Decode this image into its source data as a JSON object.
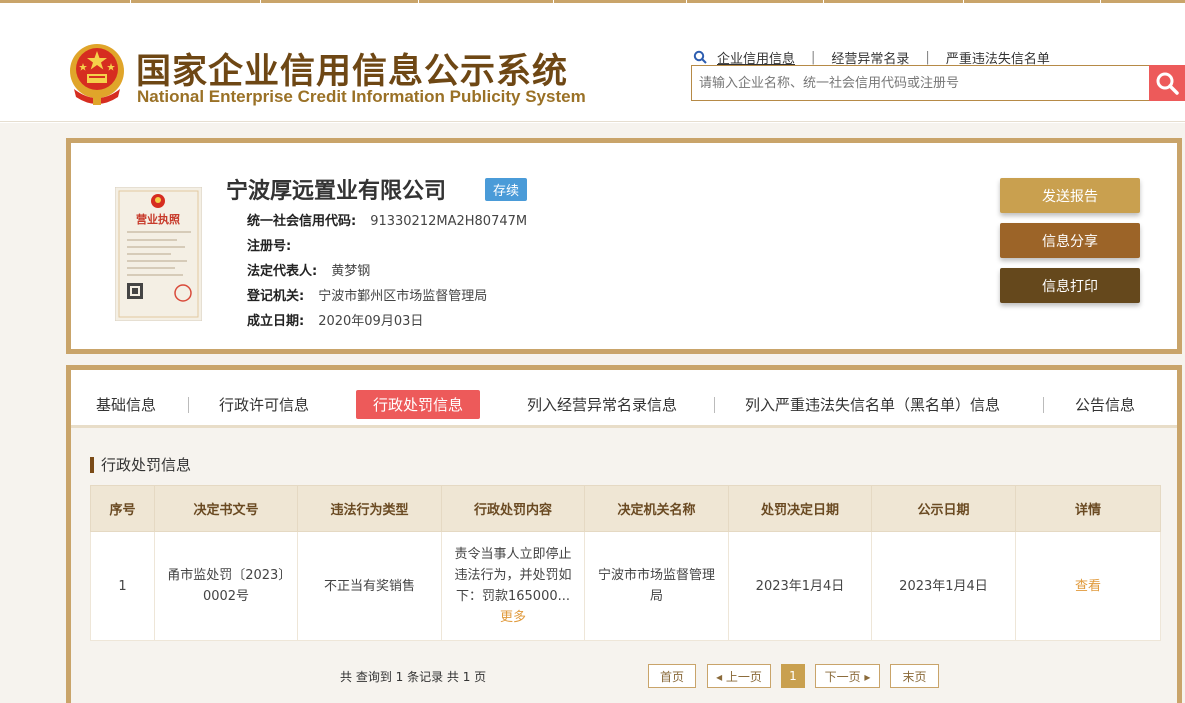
{
  "header": {
    "title_cn": "国家企业信用信息公示系统",
    "title_en": "National Enterprise Credit Information Publicity System",
    "links": [
      "企业信用信息",
      "经营异常名录",
      "严重违法失信名单"
    ],
    "search_placeholder": "请输入企业名称、统一社会信用代码或注册号"
  },
  "company": {
    "name": "宁波厚远置业有限公司",
    "status": "存续",
    "fields": [
      {
        "label": "统一社会信用代码:",
        "value": "91330212MA2H80747M"
      },
      {
        "label": "注册号:",
        "value": ""
      },
      {
        "label": "法定代表人:",
        "value": "黄梦钢"
      },
      {
        "label": "登记机关:",
        "value": "宁波市鄞州区市场监督管理局"
      },
      {
        "label": "成立日期:",
        "value": "2020年09月03日"
      }
    ],
    "license_text": "营业执照"
  },
  "actions": {
    "send_report": "发送报告",
    "share": "信息分享",
    "print": "信息打印"
  },
  "tabs": [
    {
      "label": "基础信息",
      "active": false
    },
    {
      "label": "行政许可信息",
      "active": false
    },
    {
      "label": "行政处罚信息",
      "active": true
    },
    {
      "label": "列入经营异常名录信息",
      "active": false
    },
    {
      "label": "列入严重违法失信名单（黑名单）信息",
      "active": false
    },
    {
      "label": "公告信息",
      "active": false
    }
  ],
  "section": {
    "title": "行政处罚信息",
    "columns": [
      "序号",
      "决定书文号",
      "违法行为类型",
      "行政处罚内容",
      "决定机关名称",
      "处罚决定日期",
      "公示日期",
      "详情"
    ],
    "rows": [
      {
        "index": "1",
        "doc_no": "甬市监处罚〔2023〕0002号",
        "violation": "不正当有奖销售",
        "content": "责令当事人立即停止违法行为，并处罚如下：罚款165000...",
        "more": "更多",
        "authority": "宁波市市场监督管理局",
        "decision_date": "2023年1月4日",
        "publish_date": "2023年1月4日",
        "detail": "查看"
      }
    ]
  },
  "pagination": {
    "summary": "共 查询到 1 条记录 共 1 页",
    "first": "首页",
    "prev": "◂ 上一页",
    "current": "1",
    "next": "下一页 ▸",
    "last": "末页"
  },
  "colors": {
    "gold": "#c9a46a",
    "brown_title": "#6e4714",
    "accent_red": "#ed5a5a",
    "badge_blue": "#4a9bd8"
  }
}
